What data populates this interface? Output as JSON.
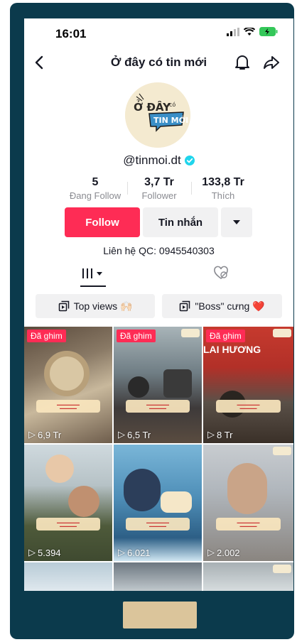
{
  "status_bar": {
    "time": "16:01"
  },
  "header": {
    "title": "Ở đây có tin mới"
  },
  "profile": {
    "avatar_text": "Ở ĐÂY có TIN MỚI",
    "handle": "@tinmoi.dt",
    "stats": [
      {
        "value": "5",
        "label": "Đang Follow"
      },
      {
        "value": "3,7 Tr",
        "label": "Follower"
      },
      {
        "value": "133,8 Tr",
        "label": "Thích"
      }
    ],
    "follow_label": "Follow",
    "message_label": "Tin nhắn",
    "contact": "Liên hệ QC: 0945540303"
  },
  "collections": [
    {
      "label": "Top views 🙌🏻"
    },
    {
      "label": "\"Boss\" cưng ❤️"
    }
  ],
  "pinned_label": "Đã ghim",
  "videos": [
    {
      "views": "6,9 Tr",
      "pinned": true
    },
    {
      "views": "6,5 Tr",
      "pinned": true
    },
    {
      "views": "8 Tr",
      "pinned": true,
      "sign_text": "LAI HƯƠNG"
    },
    {
      "views": "5.394",
      "pinned": false
    },
    {
      "views": "6.021",
      "pinned": false
    },
    {
      "views": "2.002",
      "pinned": false
    },
    {
      "views": "",
      "pinned": false
    },
    {
      "views": "",
      "pinned": false
    },
    {
      "views": "",
      "pinned": false
    }
  ],
  "colors": {
    "accent": "#fe2c55",
    "frame": "#0b3a4c",
    "verified": "#20d5ec"
  }
}
